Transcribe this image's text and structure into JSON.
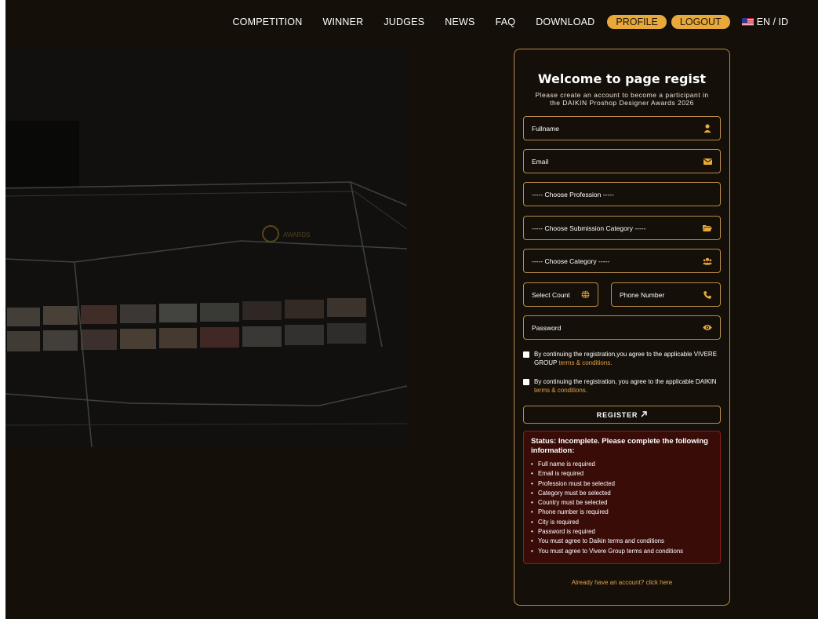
{
  "nav": {
    "items": [
      "COMPETITION",
      "WINNER",
      "JUDGES",
      "NEWS",
      "FAQ",
      "DOWNLOAD"
    ],
    "profile_label": "PROFILE",
    "logout_label": "LOGOUT",
    "lang_label": "EN / ID",
    "accent": "#e8a93b"
  },
  "hero": {
    "image_label": "AWARDS"
  },
  "form": {
    "title": "Welcome to page regist",
    "subtitle": "Please create an account to become a participant in the DAIKIN Proshop Designer Awards 2026",
    "fields": {
      "fullname": {
        "label": "Fullname",
        "icon": "user-icon"
      },
      "email": {
        "label": "Email",
        "icon": "envelope-icon"
      },
      "profession": {
        "label": "----- Choose Profession -----"
      },
      "submission_category": {
        "label": "----- Choose Submission Category -----",
        "icon": "folder-icon"
      },
      "category": {
        "label": "----- Choose Category -----",
        "icon": "users-icon"
      },
      "country": {
        "label": "Select Count",
        "icon": "globe-icon"
      },
      "phone": {
        "label": "Phone Number",
        "icon": "phone-icon"
      },
      "password": {
        "label": "Password",
        "icon": "eye-icon"
      }
    },
    "agree_vivere_text": "By continuing the registration,you agree to the applicable VIVERE GROUP",
    "agree_daikin_text": "By continuing the registration, you agree to the applicable DAIKIN",
    "terms_link": "terms & conditions.",
    "register_label": "REGISTER",
    "register_icon": "arrow-up-right-icon",
    "status": {
      "title": "Status: Incomplete. Please complete the following information:",
      "items": [
        "Full name is required",
        "Email is required",
        "Profession must be selected",
        "Category must be selected",
        "Country must be selected",
        "Phone number is required",
        "City is required",
        "Password is required",
        "You must agree to Daikin terms and conditions",
        "You must agree to Vivere Group terms and conditions"
      ],
      "color": "#3a0c08"
    },
    "login_link": "Already have an account? click here",
    "border_color": "#b98a4a",
    "link_color": "#e0a24a"
  }
}
